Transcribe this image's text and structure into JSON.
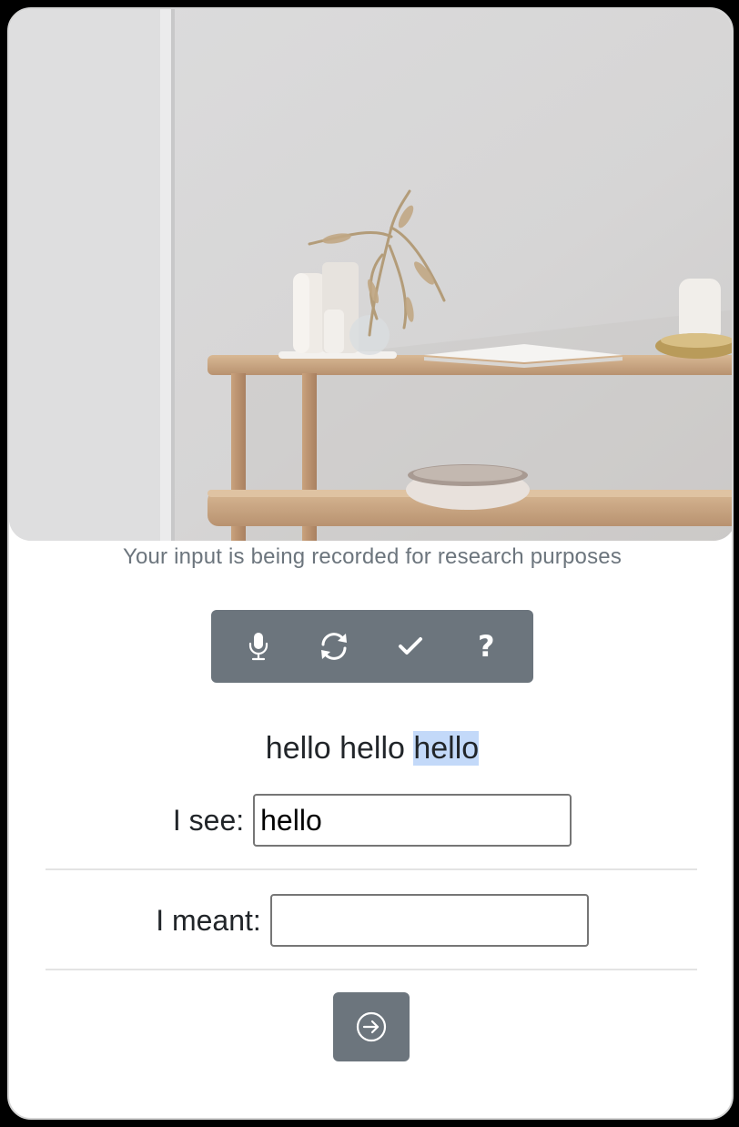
{
  "caption": "Your input is being recorded for research purposes",
  "toolbar": {
    "buttons": [
      {
        "icon": "microphone-icon"
      },
      {
        "icon": "refresh-icon"
      },
      {
        "icon": "check-icon"
      },
      {
        "icon": "question-icon",
        "glyph": "?"
      }
    ]
  },
  "transcript": {
    "before": "hello hello ",
    "highlighted": "hello",
    "highlight_color": "#c3d9f9"
  },
  "form": {
    "see_label": "I see:",
    "see_value": "hello",
    "meant_label": "I meant:",
    "meant_value": ""
  },
  "submit": {
    "icon": "arrow-right-circle-icon"
  },
  "colors": {
    "accent_gray": "#6c757d",
    "text": "#212529"
  }
}
